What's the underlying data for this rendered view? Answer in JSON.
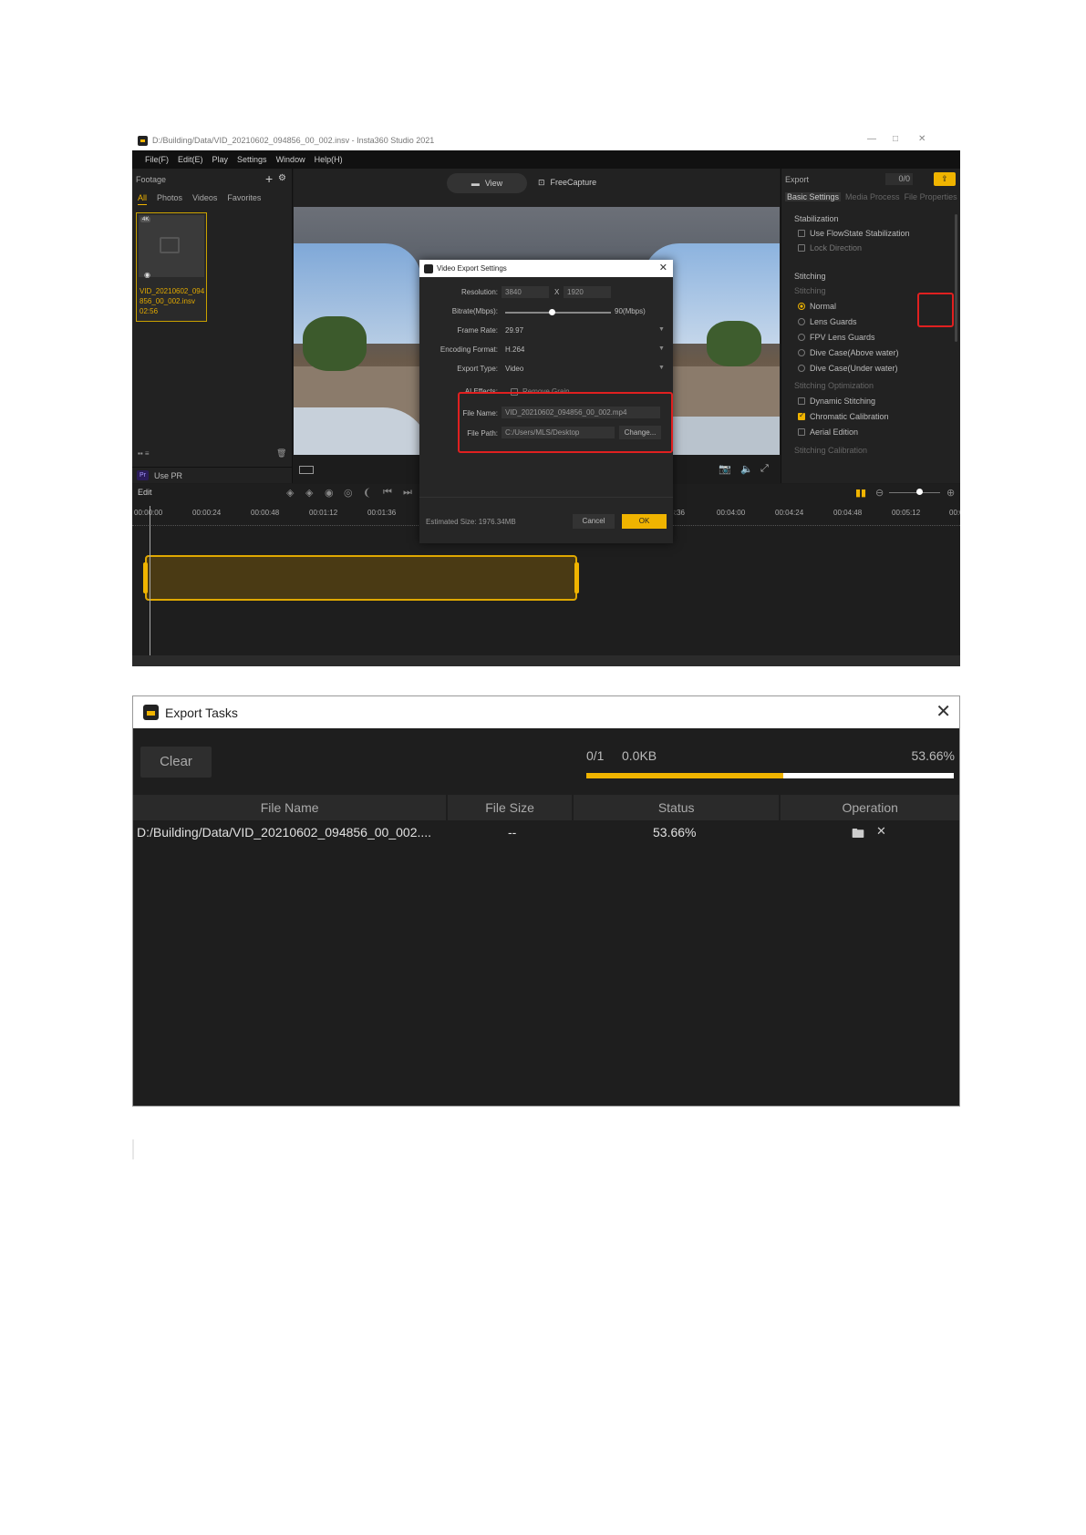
{
  "app": {
    "window_title": "D:/Building/Data/VID_20210602_094856_00_002.insv - Insta360 Studio 2021",
    "window_controls": [
      "—",
      "□",
      "✕"
    ],
    "menu": [
      "File(F)",
      "Edit(E)",
      "Play",
      "Settings",
      "Window",
      "Help(H)"
    ],
    "footage": {
      "title": "Footage",
      "tabs": [
        "All",
        "Photos",
        "Videos",
        "Favorites"
      ],
      "thumbnail": {
        "badge": "4K",
        "filename": "VID_20210602_094856_00_002.insv",
        "duration": "02:56"
      },
      "use_pr": "Use PR",
      "pr_badge": "Pr"
    },
    "viewer": {
      "view_label": "View",
      "freecapture_label": "FreeCapture"
    },
    "export_panel": {
      "title": "Export",
      "counter": "0/0",
      "tabs": [
        "Basic Settings",
        "Media Process",
        "File Properties"
      ],
      "stabilization": {
        "title": "Stabilization",
        "options": [
          "Use FlowState Stabilization",
          "Lock Direction"
        ]
      },
      "stitching": {
        "title": "Stitching",
        "sub": "Stitching",
        "options": [
          "Normal",
          "Lens Guards",
          "FPV Lens Guards",
          "Dive Case(Above water)",
          "Dive Case(Under water)"
        ],
        "optimization_title": "Stitching Optimization",
        "optimization_options": [
          "Dynamic Stitching",
          "Chromatic Calibration",
          "Aerial Edition"
        ],
        "calibration_title": "Stitching Calibration"
      }
    },
    "timeline": {
      "edit_label": "Edit",
      "ticks": [
        "00:00:00",
        "00:00:24",
        "00:00:48",
        "00:01:12",
        "00:01:36",
        "00:03:36",
        "00:04:00",
        "00:04:24",
        "00:04:48",
        "00:05:12",
        "00:0"
      ]
    },
    "dialog": {
      "title": "Video Export Settings",
      "resolution_label": "Resolution:",
      "resolution_w": "3840",
      "resolution_x": "X",
      "resolution_h": "1920",
      "bitrate_label": "Bitrate(Mbps):",
      "bitrate_value": "90(Mbps)",
      "framerate_label": "Frame Rate:",
      "framerate_value": "29.97",
      "encoding_label": "Encoding Format:",
      "encoding_value": "H.264",
      "exporttype_label": "Export Type:",
      "exporttype_value": "Video",
      "ai_label": "AI Effects:",
      "ai_option": "Remove Grain",
      "filename_label": "File Name:",
      "filename_value": "VID_20210602_094856_00_002.mp4",
      "filepath_label": "File Path:",
      "filepath_value": "C:/Users/MLS/Desktop",
      "change_label": "Change...",
      "estimated": "Estimated Size: 1976.34MB",
      "cancel_label": "Cancel",
      "ok_label": "OK"
    }
  },
  "export_tasks": {
    "title": "Export Tasks",
    "clear_label": "Clear",
    "count": "0/1",
    "size": "0.0KB",
    "percent_text": "53.66%",
    "progress": 0.5366,
    "columns": [
      "File Name",
      "File Size",
      "Status",
      "Operation"
    ],
    "rows": [
      {
        "file_name": "D:/Building/Data/VID_20210602_094856_00_002....",
        "file_size": "--",
        "status": "53.66%"
      }
    ]
  },
  "colors": {
    "accent": "#f0b400",
    "highlight": "#e02020",
    "panel_dark": "#1e1e1e"
  }
}
